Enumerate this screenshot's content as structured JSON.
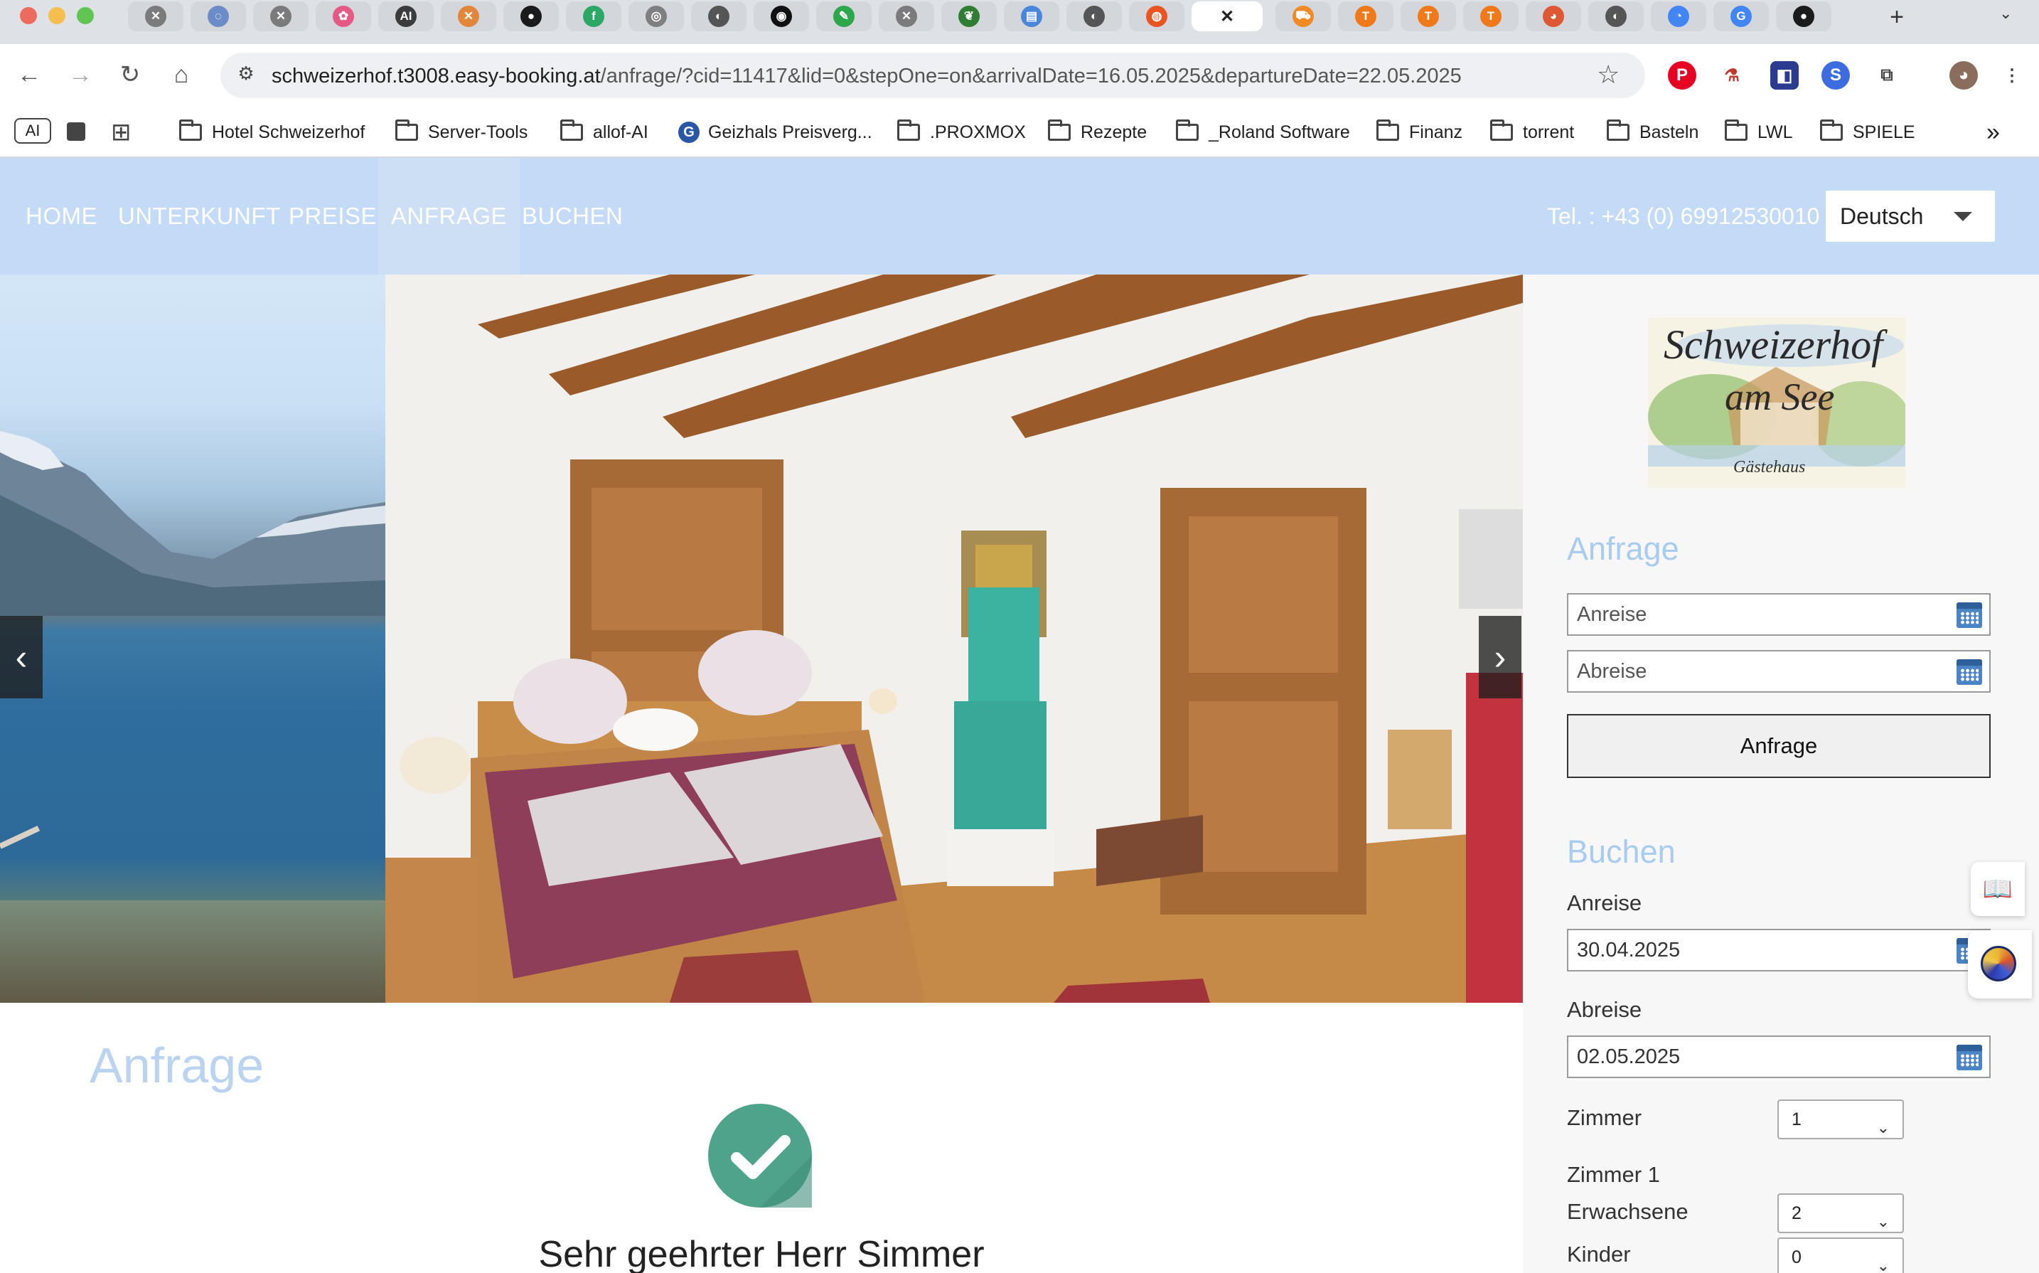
{
  "browser": {
    "url_host": "schweizerhof.t3008.easy-booking.at",
    "url_path": "/anfrage/?cid=11417&lid=0&stepOne=on&arrivalDate=16.05.2025&departureDate=22.05.2025",
    "active_tab_close": "✕",
    "new_tab": "+",
    "tab_menu": "⌄",
    "tabs": [
      {
        "icon": "x-icon",
        "glyph": "✕",
        "color": "#7b7b7b"
      },
      {
        "icon": "loop-icon",
        "glyph": "◌",
        "color": "#6b8cc9"
      },
      {
        "icon": "x-icon",
        "glyph": "✕",
        "color": "#7b7b7b"
      },
      {
        "icon": "photos-icon",
        "glyph": "✿",
        "color": "#e45a84"
      },
      {
        "icon": "ai-icon",
        "glyph": "AI",
        "color": "#3c3c3c"
      },
      {
        "icon": "x-orange-icon",
        "glyph": "✕",
        "color": "#e1863b"
      },
      {
        "icon": "github-icon",
        "glyph": "●",
        "color": "#1b1b1b"
      },
      {
        "icon": "green-app-icon",
        "glyph": "f",
        "color": "#2ca866"
      },
      {
        "icon": "grey-app-icon",
        "glyph": "◎",
        "color": "#7f7f7f"
      },
      {
        "icon": "globe-icon",
        "glyph": "◐",
        "color": "#555"
      },
      {
        "icon": "black-circle-icon",
        "glyph": "◉",
        "color": "#111"
      },
      {
        "icon": "pen-icon",
        "glyph": "✎",
        "color": "#2ea64c"
      },
      {
        "icon": "x-icon",
        "glyph": "✕",
        "color": "#7b7b7b"
      },
      {
        "icon": "leaf-icon",
        "glyph": "❦",
        "color": "#2e7d32"
      },
      {
        "icon": "doc-icon",
        "glyph": "▤",
        "color": "#4a86d9"
      },
      {
        "icon": "globe-icon",
        "glyph": "◐",
        "color": "#555"
      },
      {
        "icon": "ubuntu-icon",
        "glyph": "◍",
        "color": "#e95420"
      },
      {
        "icon": "close-active-tab",
        "glyph": "✕",
        "color": "#333"
      },
      {
        "icon": "cart-icon",
        "glyph": "⛟",
        "color": "#f08a24"
      },
      {
        "icon": "temu-icon",
        "glyph": "T",
        "color": "#f07a1a"
      },
      {
        "icon": "temu-icon",
        "glyph": "T",
        "color": "#f07a1a"
      },
      {
        "icon": "temu-icon",
        "glyph": "T",
        "color": "#f07a1a"
      },
      {
        "icon": "duckduckgo-icon",
        "glyph": "◕",
        "color": "#de5833"
      },
      {
        "icon": "globe-icon",
        "glyph": "◐",
        "color": "#555"
      },
      {
        "icon": "chrome-app-icon",
        "glyph": "◔",
        "color": "#4285f4"
      },
      {
        "icon": "google-icon",
        "glyph": "G",
        "color": "#4285f4"
      },
      {
        "icon": "github-icon",
        "glyph": "●",
        "color": "#1b1b1b"
      }
    ],
    "bookmarks": [
      {
        "label": "Hotel Schweizerhof",
        "type": "folder"
      },
      {
        "label": "Server-Tools",
        "type": "folder"
      },
      {
        "label": "allof-AI",
        "type": "folder"
      },
      {
        "label": "Geizhals Preisverg...",
        "type": "site"
      },
      {
        "label": ".PROXMOX",
        "type": "folder"
      },
      {
        "label": "Rezepte",
        "type": "folder"
      },
      {
        "label": "_Roland Software",
        "type": "folder"
      },
      {
        "label": "Finanz",
        "type": "folder"
      },
      {
        "label": "torrent",
        "type": "folder"
      },
      {
        "label": "Basteln",
        "type": "folder"
      },
      {
        "label": "LWL",
        "type": "folder"
      },
      {
        "label": "SPIELE",
        "type": "folder"
      }
    ],
    "bookmark_ai_chip": "AI",
    "bookmarks_overflow": "»"
  },
  "site": {
    "nav": [
      "HOME",
      "UNTERKUNFT",
      "PREISE",
      "ANFRAGE",
      "BUCHEN"
    ],
    "active_nav": "ANFRAGE",
    "phone": "Tel. : +43 (0) 69912530010",
    "language": "Deutsch",
    "logo_line1": "Schweizerhof",
    "logo_line2": "am See",
    "logo_line3": "Gästehaus",
    "sidebar": {
      "anfrage_title": "Anfrage",
      "anreise_placeholder": "Anreise",
      "abreise_placeholder": "Abreise",
      "anfrage_button": "Anfrage",
      "buchen_title": "Buchen",
      "anreise_label": "Anreise",
      "anreise_value": "30.04.2025",
      "abreise_label": "Abreise",
      "abreise_value": "02.05.2025",
      "zimmer_label": "Zimmer",
      "zimmer_value": "1",
      "zimmer1_label": "Zimmer 1",
      "erwachsene_label": "Erwachsene",
      "erwachsene_value": "2",
      "kinder_label": "Kinder",
      "kinder_value": "0"
    },
    "content_title": "Anfrage",
    "greeting": "Sehr geehrter Herr Simmer"
  },
  "colors": {
    "nav_bg": "#c3dbf6",
    "heading_blue": "#a8cbf0",
    "check_green": "#4ea48b"
  }
}
